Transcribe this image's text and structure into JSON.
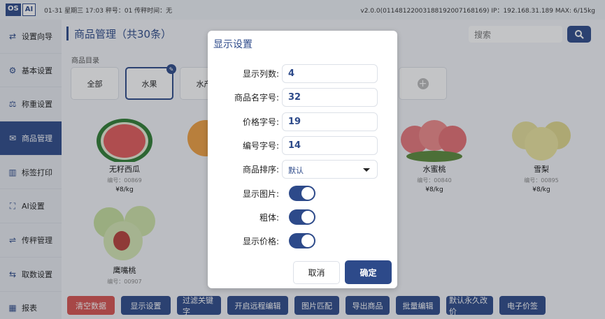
{
  "status": {
    "logo_os": "OS",
    "logo_ai": "AI",
    "left_text": "01-31 星期三 17:03  秤号：01 传秤时间：无",
    "right_text": "v2.0.0(01148122003188192007168169) IP：192.168.31.189  MAX: 6/15kg"
  },
  "sidebar": {
    "items": [
      {
        "label": "设置向导",
        "icon": "wizard-icon"
      },
      {
        "label": "基本设置",
        "icon": "gear-icon"
      },
      {
        "label": "称重设置",
        "icon": "scale-icon"
      },
      {
        "label": "商品管理",
        "icon": "product-icon"
      },
      {
        "label": "标签打印",
        "icon": "barcode-icon"
      },
      {
        "label": "AI设置",
        "icon": "ai-scan-icon"
      },
      {
        "label": "传秤管理",
        "icon": "transfer-icon"
      },
      {
        "label": "取数设置",
        "icon": "fetch-icon"
      },
      {
        "label": "报表",
        "icon": "report-icon"
      }
    ],
    "active_index": 3
  },
  "main": {
    "title": "商品管理（共30条）",
    "search_placeholder": "搜索",
    "category_label": "商品目录",
    "categories": [
      "全部",
      "水果",
      "水产"
    ],
    "products": [
      {
        "name": "无籽西瓜",
        "code": "编号：00869",
        "price": "¥8/kg"
      },
      {
        "name": "水蜜桃",
        "code": "编号：00840",
        "price": "¥8/kg"
      },
      {
        "name": "雪梨",
        "code": "编号：00895",
        "price": "¥8/kg"
      },
      {
        "name": "鹰嘴桃",
        "code": "编号：00907",
        "price": "¥8/kg"
      }
    ]
  },
  "bottom_buttons": [
    "清空数据",
    "显示设置",
    "过滤关键字",
    "开启远程编辑",
    "图片匹配",
    "导出商品",
    "批量编辑",
    "默认永久改价",
    "电子价签"
  ],
  "dialog": {
    "title": "显示设置",
    "fields": {
      "columns_label": "显示列数:",
      "columns_value": "4",
      "name_size_label": "商品名字号:",
      "name_size_value": "32",
      "price_size_label": "价格字号:",
      "price_size_value": "19",
      "code_size_label": "编号字号:",
      "code_size_value": "14",
      "sort_label": "商品排序:",
      "sort_value": "默认",
      "show_image_label": "显示图片:",
      "show_image_on": true,
      "bold_label": "粗体:",
      "bold_on": true,
      "show_price_label": "显示价格:",
      "show_price_on": true
    },
    "cancel_label": "取消",
    "ok_label": "确定"
  },
  "colors": {
    "accent": "#2d4a8a",
    "danger": "#d9534f"
  }
}
